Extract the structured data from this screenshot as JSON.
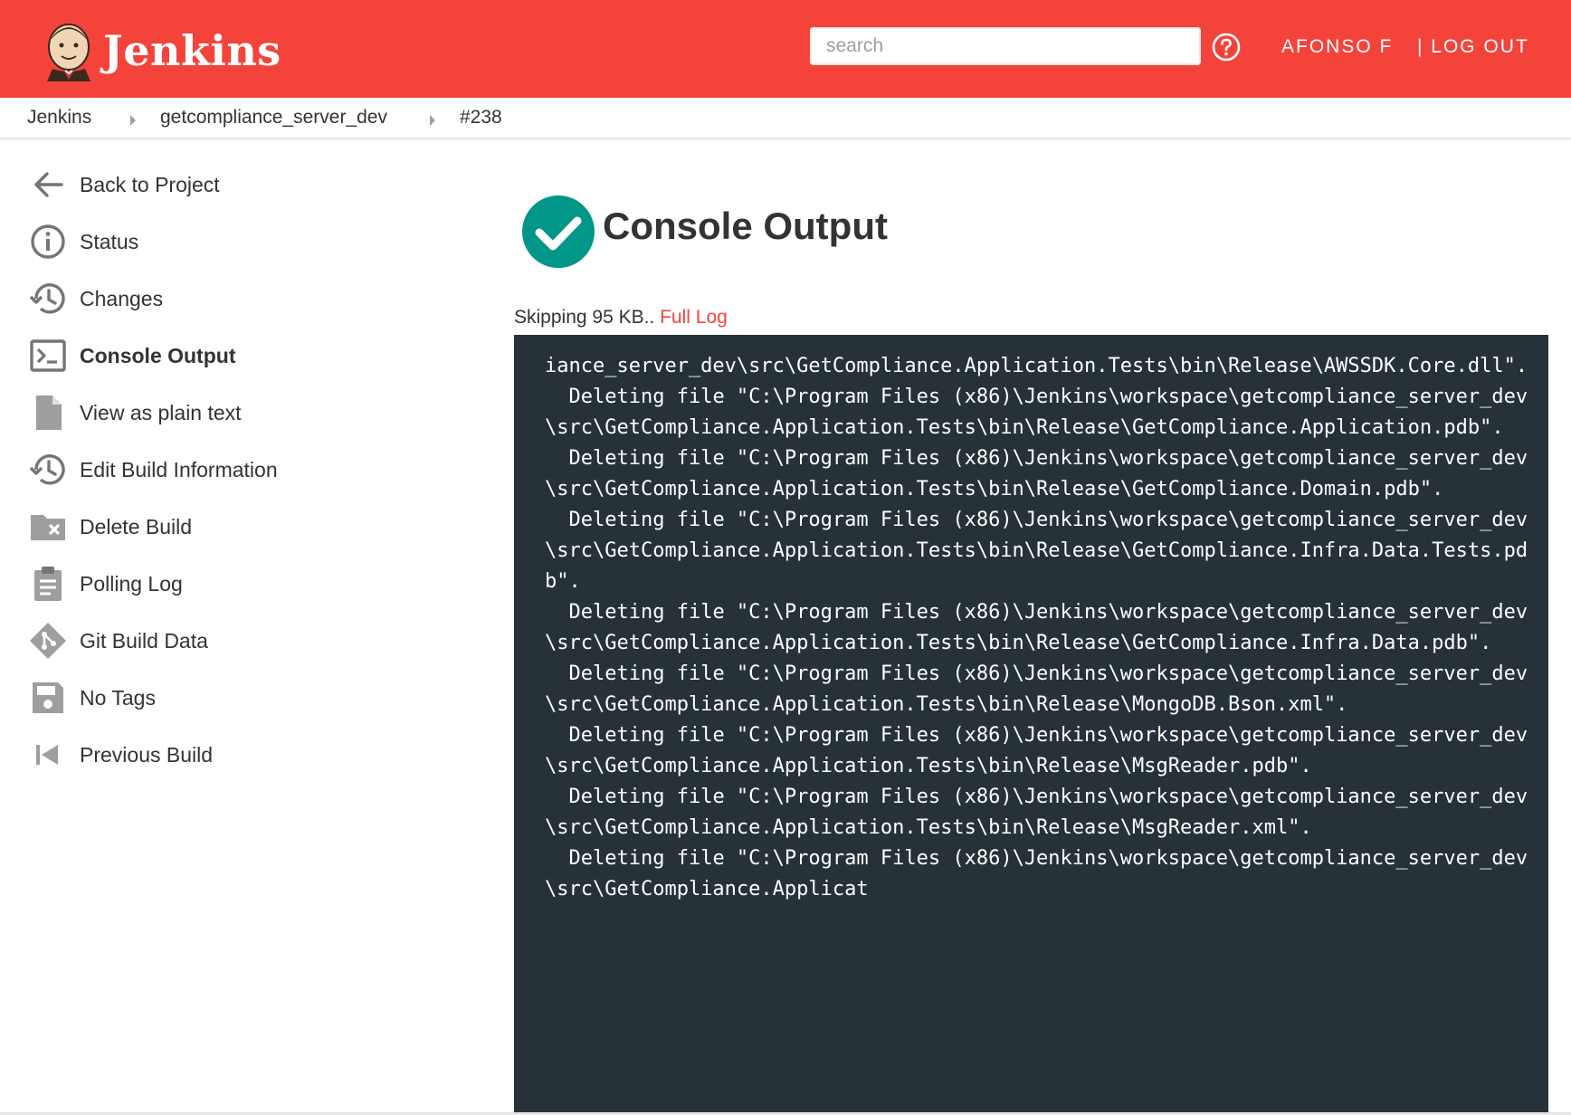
{
  "header": {
    "brand": "Jenkins",
    "search_placeholder": "search",
    "user": "AFONSO F",
    "logout": "| LOG OUT",
    "accent_color": "#f4433b"
  },
  "breadcrumb": [
    "Jenkins",
    "getcompliance_server_dev",
    "#238"
  ],
  "sidebar": {
    "items": [
      {
        "label": "Back to Project",
        "icon": "arrow-left-icon"
      },
      {
        "label": "Status",
        "icon": "info-icon"
      },
      {
        "label": "Changes",
        "icon": "history-icon"
      },
      {
        "label": "Console Output",
        "icon": "terminal-icon",
        "active": true
      },
      {
        "label": "View as plain text",
        "icon": "document-icon"
      },
      {
        "label": "Edit Build Information",
        "icon": "history-icon"
      },
      {
        "label": "Delete Build",
        "icon": "folder-delete-icon"
      },
      {
        "label": "Polling Log",
        "icon": "clipboard-icon"
      },
      {
        "label": "Git Build Data",
        "icon": "git-icon"
      },
      {
        "label": "No Tags",
        "icon": "save-icon"
      },
      {
        "label": "Previous Build",
        "icon": "skip-previous-icon"
      }
    ]
  },
  "main": {
    "title": "Console Output",
    "status_color": "#009688",
    "skip_text": "Skipping 95 KB.. ",
    "full_log_link": "Full Log",
    "console_background": "#263238",
    "console_text": "iance_server_dev\\src\\GetCompliance.Application.Tests\\bin\\Release\\AWSSDK.Core.dll\".\n  Deleting file \"C:\\Program Files (x86)\\Jenkins\\workspace\\getcompliance_server_dev\\src\\GetCompliance.Application.Tests\\bin\\Release\\GetCompliance.Application.pdb\".\n  Deleting file \"C:\\Program Files (x86)\\Jenkins\\workspace\\getcompliance_server_dev\\src\\GetCompliance.Application.Tests\\bin\\Release\\GetCompliance.Domain.pdb\".\n  Deleting file \"C:\\Program Files (x86)\\Jenkins\\workspace\\getcompliance_server_dev\\src\\GetCompliance.Application.Tests\\bin\\Release\\GetCompliance.Infra.Data.Tests.pdb\".\n  Deleting file \"C:\\Program Files (x86)\\Jenkins\\workspace\\getcompliance_server_dev\\src\\GetCompliance.Application.Tests\\bin\\Release\\GetCompliance.Infra.Data.pdb\".\n  Deleting file \"C:\\Program Files (x86)\\Jenkins\\workspace\\getcompliance_server_dev\\src\\GetCompliance.Application.Tests\\bin\\Release\\MongoDB.Bson.xml\".\n  Deleting file \"C:\\Program Files (x86)\\Jenkins\\workspace\\getcompliance_server_dev\\src\\GetCompliance.Application.Tests\\bin\\Release\\MsgReader.pdb\".\n  Deleting file \"C:\\Program Files (x86)\\Jenkins\\workspace\\getcompliance_server_dev\\src\\GetCompliance.Application.Tests\\bin\\Release\\MsgReader.xml\".\n  Deleting file \"C:\\Program Files (x86)\\Jenkins\\workspace\\getcompliance_server_dev\\src\\GetCompliance.Applicat"
  }
}
